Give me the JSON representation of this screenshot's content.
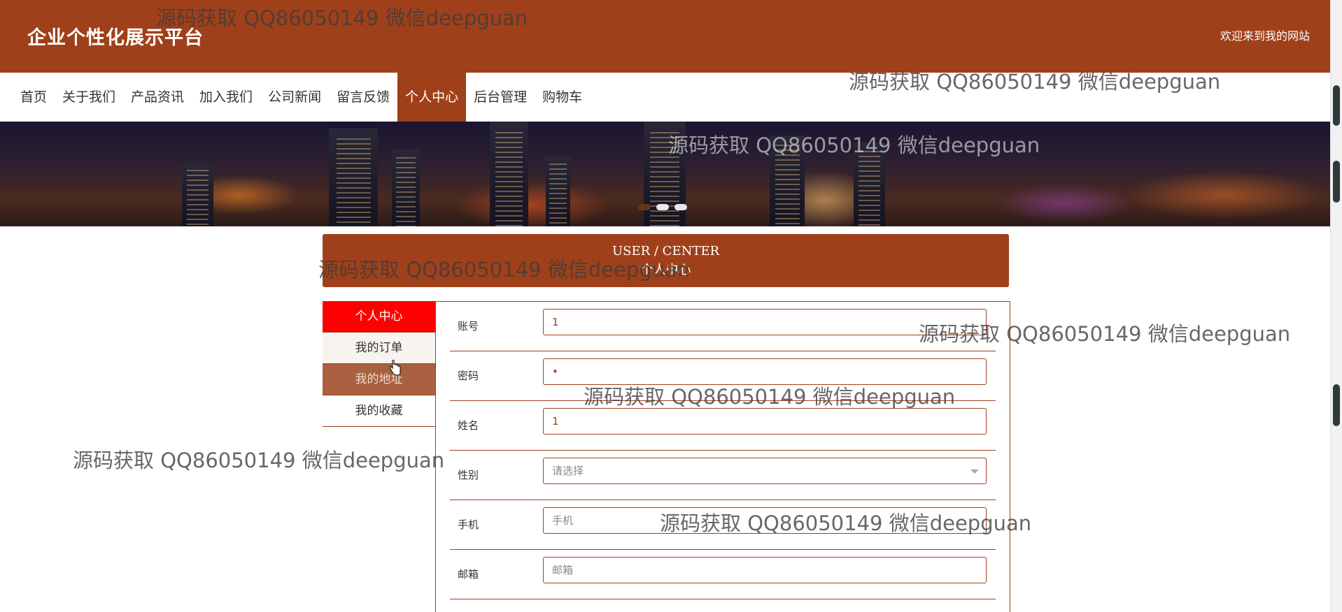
{
  "header": {
    "site_title": "企业个性化展示平台",
    "welcome": "欢迎来到我的网站"
  },
  "nav": {
    "items": [
      {
        "label": "首页"
      },
      {
        "label": "关于我们"
      },
      {
        "label": "产品资讯"
      },
      {
        "label": "加入我们"
      },
      {
        "label": "公司新闻"
      },
      {
        "label": "留言反馈"
      },
      {
        "label": "个人中心",
        "active": true
      },
      {
        "label": "后台管理"
      },
      {
        "label": "购物车"
      }
    ]
  },
  "banner": {
    "slides": 3,
    "active_slide": 1
  },
  "user_center": {
    "title_en": "USER / CENTER",
    "title_cn": "个人中心"
  },
  "side_menu": {
    "items": [
      {
        "label": "个人中心",
        "state": "active"
      },
      {
        "label": "我的订单",
        "state": "hover"
      },
      {
        "label": "我的地址",
        "state": "highlight"
      },
      {
        "label": "我的收藏",
        "state": "normal"
      }
    ]
  },
  "form": {
    "fields": [
      {
        "label": "账号",
        "value": "1",
        "placeholder": ""
      },
      {
        "label": "密码",
        "value": "•",
        "placeholder": ""
      },
      {
        "label": "姓名",
        "value": "1",
        "placeholder": ""
      },
      {
        "label": "性别",
        "value": "",
        "placeholder": "请选择",
        "type": "select"
      },
      {
        "label": "手机",
        "value": "",
        "placeholder": "手机"
      },
      {
        "label": "邮箱",
        "value": "",
        "placeholder": "邮箱"
      }
    ]
  },
  "watermark": "源码获取 QQ86050149 微信deepguan",
  "colors": {
    "brand": "#a0401a",
    "active_red": "#ff0000"
  }
}
